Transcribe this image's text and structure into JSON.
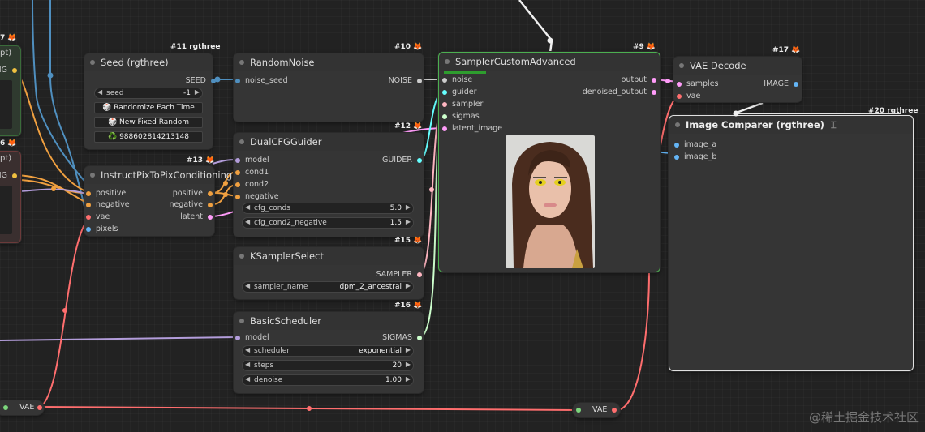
{
  "colors": {
    "clip": "#f0c040",
    "conditioning": "#f0a040",
    "vae": "#ff6e6e",
    "latent": "#ff9cf9",
    "model": "#b39ddb",
    "noise": "#4f8fbf",
    "guider": "#66ffff",
    "sampler": "#ffb6c1",
    "sigmas": "#cdffcd",
    "image": "#64b5f6"
  },
  "edge": {
    "left_top_partial": "7",
    "left_top_badge": "🦊",
    "left_top_label": "pt)",
    "left_top_slot": "NG",
    "left_mid_partial": "6",
    "left_mid_label": "pt)",
    "left_mid_slot": "NG",
    "vae_left": "VAE",
    "vae_right": "VAE"
  },
  "nodes": {
    "seed": {
      "badge": "#11 rgthree",
      "title": "Seed (rgthree)",
      "out": "SEED",
      "widget_label": "seed",
      "widget_value": "-1",
      "btn1": "🎲 Randomize Each Time",
      "btn2": "🎲 New Fixed Random",
      "btn3": "♻️ 988602814213148"
    },
    "random_noise": {
      "badge": "#10",
      "title": "RandomNoise",
      "in": "noise_seed",
      "out": "NOISE"
    },
    "dual_cfg": {
      "badge": "#12",
      "title": "DualCFGGuider",
      "in": [
        "model",
        "cond1",
        "cond2",
        "negative"
      ],
      "out": "GUIDER",
      "w1_label": "cfg_conds",
      "w1_value": "5.0",
      "w2_label": "cfg_cond2_negative",
      "w2_value": "1.5"
    },
    "ip2p": {
      "badge": "#13",
      "title": "InstructPixToPixConditioning",
      "in": [
        "positive",
        "negative",
        "vae",
        "pixels"
      ],
      "out": [
        "positive",
        "negative",
        "latent"
      ]
    },
    "ksampler_select": {
      "badge": "#15",
      "title": "KSamplerSelect",
      "out": "SAMPLER",
      "w_label": "sampler_name",
      "w_value": "dpm_2_ancestral"
    },
    "basic_scheduler": {
      "badge": "#16",
      "title": "BasicScheduler",
      "in": "model",
      "out": "SIGMAS",
      "w1_label": "scheduler",
      "w1_value": "exponential",
      "w2_label": "steps",
      "w2_value": "20",
      "w3_label": "denoise",
      "w3_value": "1.00"
    },
    "sampler_custom": {
      "badge": "#9",
      "title": "SamplerCustomAdvanced",
      "in": [
        "noise",
        "guider",
        "sampler",
        "sigmas",
        "latent_image"
      ],
      "out": [
        "output",
        "denoised_output"
      ]
    },
    "vae_decode": {
      "badge": "#17",
      "title": "VAE Decode",
      "in": [
        "samples",
        "vae"
      ],
      "out": "IMAGE"
    },
    "image_comparer": {
      "badge": "#20 rgthree",
      "title": "Image Comparer (rgthree)",
      "in": [
        "image_a",
        "image_b"
      ]
    }
  },
  "watermark": "@稀土掘金技术社区"
}
